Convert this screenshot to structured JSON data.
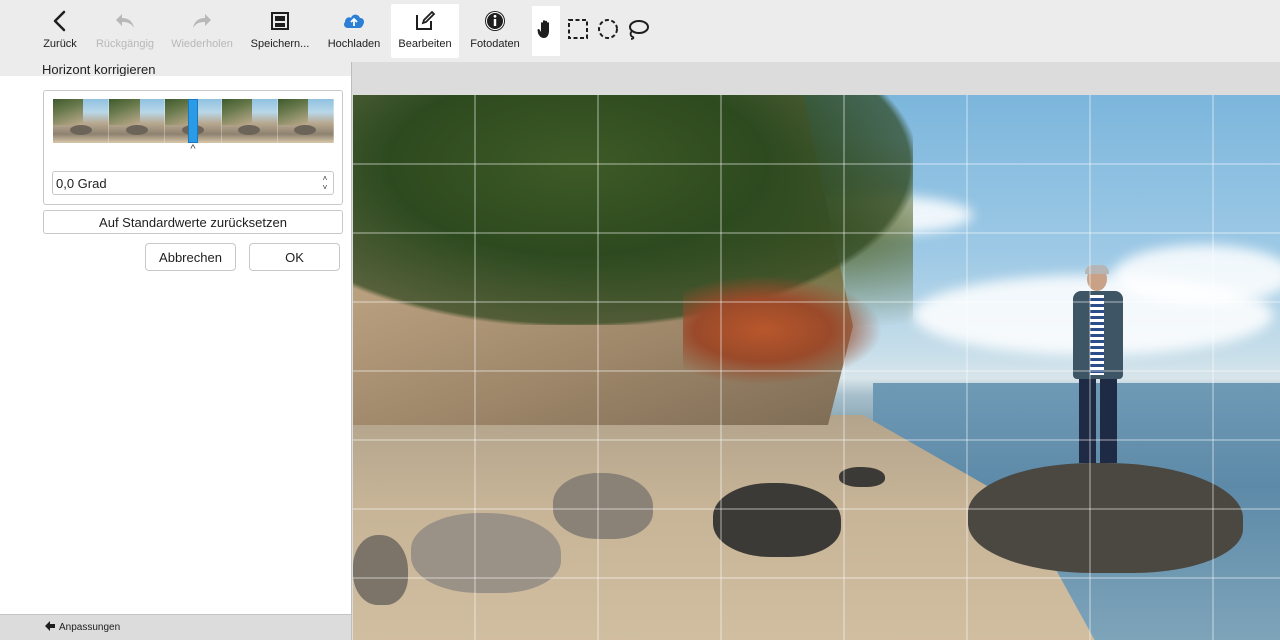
{
  "toolbar": {
    "back": "Zurück",
    "undo": "Rückgängig",
    "redo": "Wiederholen",
    "save": "Speichern...",
    "upload": "Hochladen",
    "edit": "Bearbeiten",
    "photo_data": "Fotodaten"
  },
  "panel": {
    "title": "Horizont korrigieren",
    "angle_value": "0,0 Grad",
    "reset_label": "Auf Standardwerte zurücksetzen",
    "cancel_label": "Abbrechen",
    "ok_label": "OK"
  },
  "bottom_bar": {
    "label": "Anpassungen"
  },
  "icons": {
    "back": "chevron-left-icon",
    "undo": "undo-icon",
    "redo": "redo-icon",
    "save": "save-icon",
    "upload": "cloud-upload-icon",
    "edit": "edit-icon",
    "photo_data": "info-icon",
    "hand": "hand-icon",
    "rect_select": "rect-select-icon",
    "ellipse_select": "ellipse-select-icon",
    "lasso": "lasso-icon"
  },
  "colors": {
    "accent": "#2a9be6",
    "upload_icon": "#2b7fd4",
    "disabled": "#b8b8b8"
  }
}
